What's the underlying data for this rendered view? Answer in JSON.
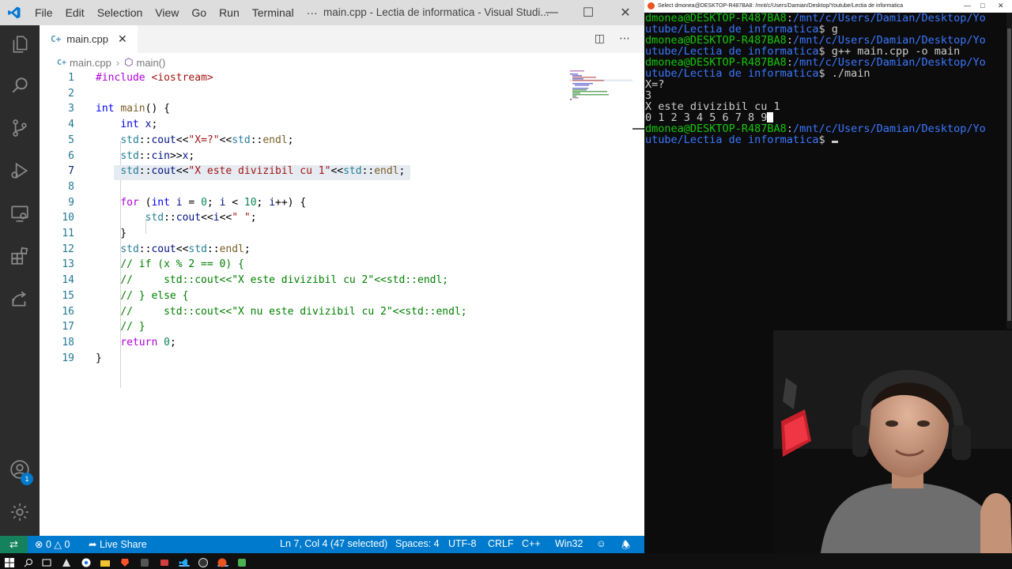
{
  "vscode": {
    "menu": [
      "File",
      "Edit",
      "Selection",
      "View",
      "Go",
      "Run",
      "Terminal",
      "···"
    ],
    "window_title": "main.cpp - Lectia de informatica - Visual Studi...",
    "tab": {
      "label": "main.cpp"
    },
    "breadcrumb": {
      "file": "main.cpp",
      "symbol": "main()"
    },
    "line_numbers": [
      "1",
      "2",
      "3",
      "4",
      "5",
      "6",
      "7",
      "8",
      "9",
      "10",
      "11",
      "12",
      "13",
      "14",
      "15",
      "16",
      "17",
      "18",
      "19"
    ],
    "activity_badge": "1",
    "status": {
      "problems_errors": "0",
      "problems_warnings": "0",
      "live_share": "Live Share",
      "cursor": "Ln 7, Col 4 (47 selected)",
      "spaces": "Spaces: 4",
      "encoding": "UTF-8",
      "eol": "CRLF",
      "language": "C++",
      "platform": "Win32"
    }
  },
  "terminal": {
    "title": "Select dmonea@DESKTOP-R487BA8: /mnt/c/Users/Damian/Desktop/Youtube/Lectia de informatica",
    "user": "dmonea@DESKTOP-R487BA8",
    "path1": "/mnt/c/Users/Damian/Desktop/Yo",
    "path2": "utube/Lectia de informatica",
    "cmd1": "g",
    "cmd2": "g++ main.cpp -o main",
    "cmd3": "./main",
    "out1": "X=?",
    "out2": "3",
    "out3": "X este divizibil cu 1",
    "out4": "0 1 2 3 4 5 6 7 8 9"
  },
  "icons": {
    "activity": [
      "files-icon",
      "search-icon",
      "source-control-icon",
      "run-debug-icon",
      "remote-explorer-icon",
      "extensions-icon",
      "live-share-icon",
      "account-icon",
      "settings-gear-icon"
    ],
    "taskbar": [
      "windows-start-icon",
      "search-icon",
      "task-view-icon",
      "app-icon",
      "chrome-icon",
      "file-explorer-icon",
      "brave-icon",
      "app-icon",
      "vscode-icon",
      "obs-icon",
      "ubuntu-icon",
      "app-icon"
    ]
  },
  "colors": {
    "statusbar": "#007acc",
    "remote": "#16825d",
    "terminal_green": "#16c60c",
    "terminal_blue": "#3b78ff"
  }
}
